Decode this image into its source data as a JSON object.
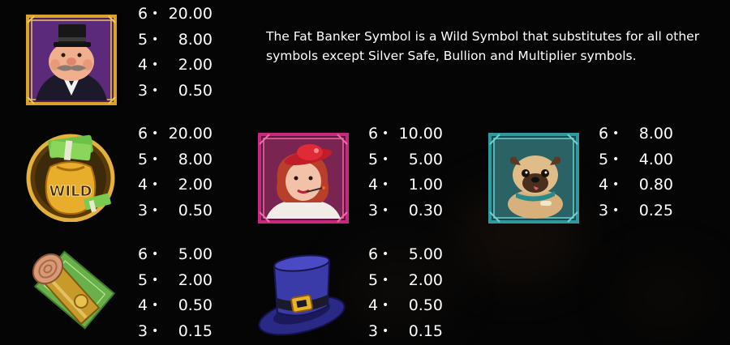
{
  "description": "The Fat Banker Symbol is a Wild Symbol that substitutes for all other symbols except Silver Safe, Bullion and Multiplier symbols.",
  "symbols": [
    {
      "icon": "fat-banker-icon",
      "pays": [
        {
          "count": "6",
          "value": "20.00"
        },
        {
          "count": "5",
          "value": "8.00"
        },
        {
          "count": "4",
          "value": "2.00"
        },
        {
          "count": "3",
          "value": "0.50"
        }
      ]
    },
    {
      "icon": "wild-money-bag-icon",
      "label": "WILD",
      "pays": [
        {
          "count": "6",
          "value": "20.00"
        },
        {
          "count": "5",
          "value": "8.00"
        },
        {
          "count": "4",
          "value": "2.00"
        },
        {
          "count": "3",
          "value": "0.50"
        }
      ]
    },
    {
      "icon": "lady-red-hat-icon",
      "pays": [
        {
          "count": "6",
          "value": "10.00"
        },
        {
          "count": "5",
          "value": "5.00"
        },
        {
          "count": "4",
          "value": "1.00"
        },
        {
          "count": "3",
          "value": "0.30"
        }
      ]
    },
    {
      "icon": "pug-dog-icon",
      "pays": [
        {
          "count": "6",
          "value": "8.00"
        },
        {
          "count": "5",
          "value": "4.00"
        },
        {
          "count": "4",
          "value": "0.80"
        },
        {
          "count": "3",
          "value": "0.25"
        }
      ]
    },
    {
      "icon": "gold-coin-roll-icon",
      "pays": [
        {
          "count": "6",
          "value": "5.00"
        },
        {
          "count": "5",
          "value": "2.00"
        },
        {
          "count": "4",
          "value": "0.50"
        },
        {
          "count": "3",
          "value": "0.15"
        }
      ]
    },
    {
      "icon": "top-hat-icon",
      "pays": [
        {
          "count": "6",
          "value": "5.00"
        },
        {
          "count": "5",
          "value": "2.00"
        },
        {
          "count": "4",
          "value": "0.50"
        },
        {
          "count": "3",
          "value": "0.15"
        }
      ]
    }
  ],
  "colors": {
    "background": "#050505",
    "text": "#ffffff",
    "gold": "#d9a32a",
    "teal": "#2f9a9e",
    "magenta": "#c8287e"
  }
}
